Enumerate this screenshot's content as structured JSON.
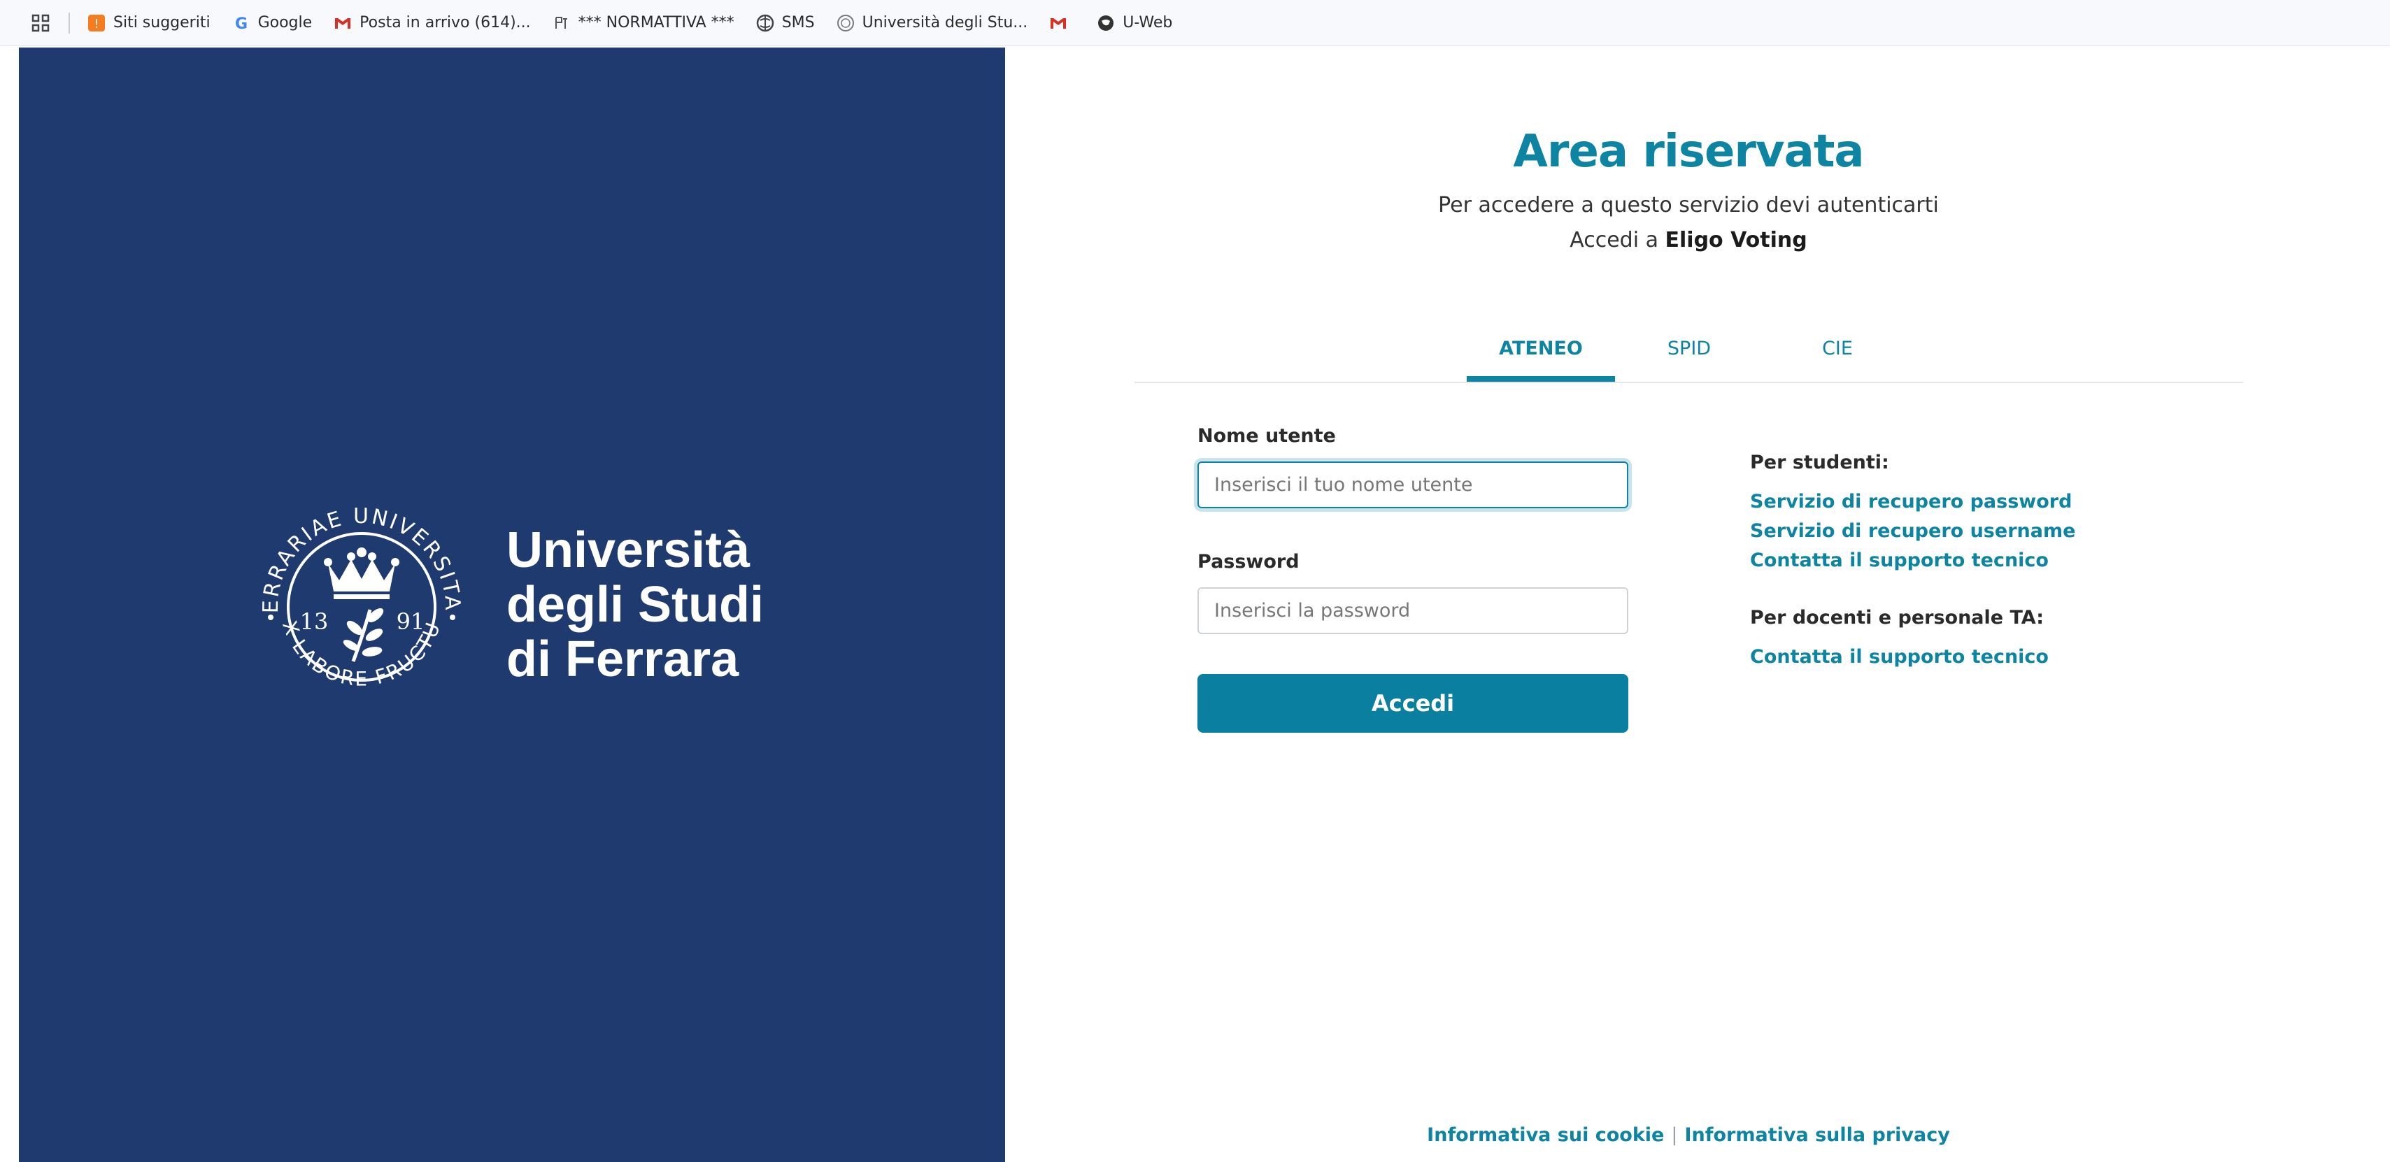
{
  "bookmarks": {
    "items": [
      {
        "label": "Siti suggeriti",
        "icon": "suggested-sites-icon"
      },
      {
        "label": "Google",
        "icon": "google-icon"
      },
      {
        "label": "Posta in arrivo (614)...",
        "icon": "gmail-icon"
      },
      {
        "label": "*** NORMATTIVA ***",
        "icon": "normattiva-icon"
      },
      {
        "label": "SMS",
        "icon": "globe-icon"
      },
      {
        "label": "Università degli Stu...",
        "icon": "unife-icon"
      },
      {
        "label": "",
        "icon": "gmail-icon"
      },
      {
        "label": "U-Web",
        "icon": "globe-icon"
      }
    ]
  },
  "brand": {
    "name_lines": [
      "Università",
      "degli Studi",
      "di Ferrara"
    ],
    "seal": {
      "top_text": "FERRARIAE UNIVERSITAS",
      "bottom_text": "EX LABORE FRUCTUS",
      "year_left": "13",
      "year_right": "91"
    }
  },
  "login": {
    "title": "Area riservata",
    "subtitle": "Per accedere a questo servizio devi autenticarti",
    "access_prefix": "Accedi a ",
    "service_name": "Eligo Voting",
    "tabs": [
      {
        "label": "ATENEO",
        "active": true
      },
      {
        "label": "SPID",
        "active": false
      },
      {
        "label": "CIE",
        "active": false
      }
    ],
    "username_label": "Nome utente",
    "username_placeholder": "Inserisci il tuo nome utente",
    "password_label": "Password",
    "password_placeholder": "Inserisci la password",
    "submit_label": "Accedi"
  },
  "help": {
    "students_heading": "Per studenti:",
    "students_links": [
      "Servizio di recupero password",
      "Servizio di recupero username",
      "Contatta il supporto tecnico"
    ],
    "staff_heading": "Per docenti e personale TA:",
    "staff_links": [
      "Contatta il supporto tecnico"
    ]
  },
  "footer": {
    "cookie_label": "Informativa sui cookie",
    "separator": "|",
    "privacy_label": "Informativa sulla privacy"
  },
  "colors": {
    "brand_blue": "#1f3a6e",
    "accent": "#0e84a3"
  }
}
